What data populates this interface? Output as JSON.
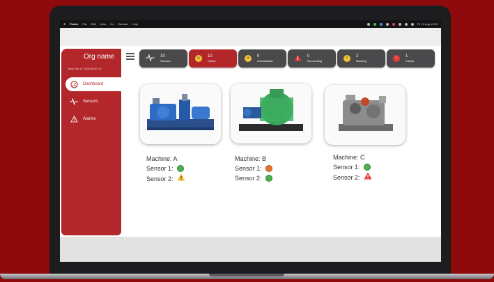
{
  "menubar": {
    "app_name": "Finder",
    "menus": [
      "File",
      "Edit",
      "View",
      "Go",
      "Window",
      "Help"
    ],
    "clock": "Fri 23 Aug 10:00"
  },
  "sidebar": {
    "org_name": "Org name",
    "timestamp": "Mon Jun 17 2024 00:47:10",
    "items": [
      {
        "label": "Dashboard",
        "icon": "gauge-icon",
        "active": true
      },
      {
        "label": "Sensors",
        "icon": "pulse-icon",
        "active": false
      },
      {
        "label": "Alarms",
        "icon": "warning-icon",
        "active": false
      }
    ]
  },
  "status_pills": [
    {
      "count": "10",
      "label": "Sensors",
      "icon": "pulse-icon",
      "style": "dark"
    },
    {
      "count": "10",
      "label": "Online",
      "icon": "smile-icon",
      "style": "online",
      "icon_color": "#f3c13a"
    },
    {
      "count": "0",
      "label": "Unreachable",
      "icon": "neutral-face-icon",
      "style": "dark",
      "icon_color": "#f3c13a"
    },
    {
      "count": "0",
      "label": "Not working",
      "icon": "alert-triangle-icon",
      "style": "dark",
      "icon_color": "#e33a3a"
    },
    {
      "count": "2",
      "label": "Warning",
      "icon": "exclamation-circle-icon",
      "style": "dark",
      "icon_color": "#f3c13a"
    },
    {
      "count": "1",
      "label": "Critical",
      "icon": "critical-circle-icon",
      "style": "dark",
      "icon_color": "#e33a3a"
    }
  ],
  "machines": [
    {
      "name_line": "Machine: A",
      "image": "blue-pump-machine",
      "sensors": [
        {
          "label": "Sensor 1:",
          "status": "ok",
          "icon": "green-dot-icon"
        },
        {
          "label": "Sensor 2:",
          "status": "warning",
          "icon": "yellow-warning-icon"
        }
      ]
    },
    {
      "name_line": "Machine: B",
      "image": "green-motor-machine",
      "sensors": [
        {
          "label": "Sensor 1:",
          "status": "unreachable",
          "icon": "orange-dot-icon"
        },
        {
          "label": "Sensor 2:",
          "status": "ok",
          "icon": "green-dot-icon"
        }
      ]
    },
    {
      "name_line": "Machine: C",
      "image": "grey-compressor-machine",
      "sensors": [
        {
          "label": "Sensor 1:",
          "status": "ok",
          "icon": "green-dot-icon"
        },
        {
          "label": "Sensor 2:",
          "status": "critical",
          "icon": "red-alert-icon"
        }
      ]
    }
  ],
  "colors": {
    "brand_red": "#b3262a",
    "background_red": "#8e0a0c",
    "pill_dark": "#4a4a4c",
    "ok_green": "#4caf50",
    "unreachable_orange": "#e8742c",
    "warning_yellow": "#f3c13a",
    "critical_red": "#e33a3a"
  }
}
